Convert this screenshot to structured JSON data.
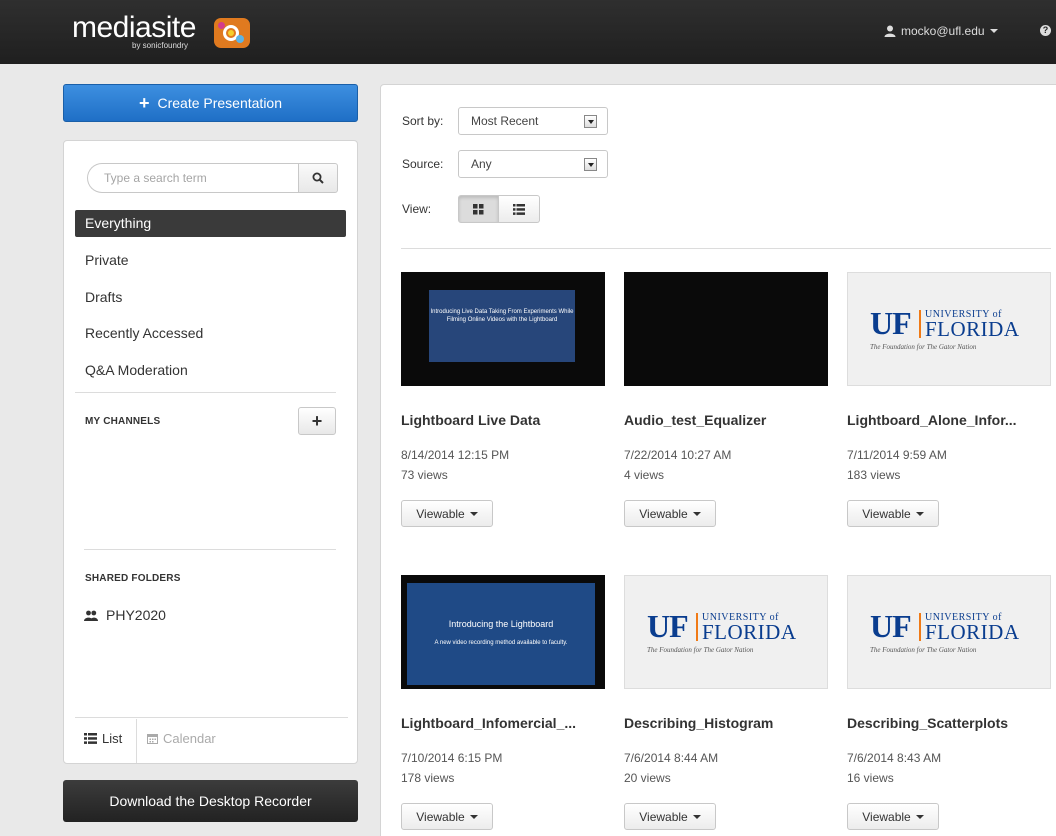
{
  "header": {
    "logo_text": "mediasite",
    "logo_sub": "by sonicfoundry",
    "user_email": "mocko@ufl.edu",
    "help_glyph": "?"
  },
  "sidebar": {
    "create_label": "Create Presentation",
    "search_placeholder": "Type a search term",
    "nav_items": [
      "Everything",
      "Private",
      "Drafts",
      "Recently Accessed",
      "Q&A Moderation"
    ],
    "my_channels_title": "MY CHANNELS",
    "shared_folders_title": "SHARED FOLDERS",
    "shared_folders": [
      "PHY2020"
    ],
    "tab_list": "List",
    "tab_calendar": "Calendar",
    "download_label": "Download the Desktop Recorder"
  },
  "filters": {
    "sort_label": "Sort by:",
    "sort_value": "Most Recent",
    "source_label": "Source:",
    "source_value": "Any",
    "view_label": "View:"
  },
  "presentations": [
    {
      "title": "Lightboard Live Data",
      "date": "8/14/2014 12:15 PM",
      "views": "73 views",
      "status": "Viewable",
      "thumb": "slide",
      "slide_text": "Introducing Live Data Taking From Experiments While Filming Online Videos with the Lightboard"
    },
    {
      "title": "Audio_test_Equalizer",
      "date": "7/22/2014 10:27 AM",
      "views": "4 views",
      "status": "Viewable",
      "thumb": "dark"
    },
    {
      "title": "Lightboard_Alone_Infor...",
      "date": "7/11/2014 9:59 AM",
      "views": "183 views",
      "status": "Viewable",
      "thumb": "uf"
    },
    {
      "title": "Lightboard_Infomercial_...",
      "date": "7/10/2014 6:15 PM",
      "views": "178 views",
      "status": "Viewable",
      "thumb": "slide2",
      "slide_title": "Introducing the Lightboard",
      "slide_sub": "A new video recording method available to faculty."
    },
    {
      "title": "Describing_Histogram",
      "date": "7/6/2014 8:44 AM",
      "views": "20 views",
      "status": "Viewable",
      "thumb": "uf"
    },
    {
      "title": "Describing_Scatterplots",
      "date": "7/6/2014 8:43 AM",
      "views": "16 views",
      "status": "Viewable",
      "thumb": "uf"
    }
  ],
  "uf_logo": {
    "letters": "UF",
    "university": "UNIVERSITY of",
    "florida": "FLORIDA",
    "tagline": "The Foundation for The Gator Nation"
  },
  "colors": {
    "accent_blue": "#1f6fc6",
    "topbar": "#232323",
    "active_nav": "#3a3a3a",
    "uf_blue": "#0a3d8f",
    "uf_orange": "#f07a16"
  }
}
